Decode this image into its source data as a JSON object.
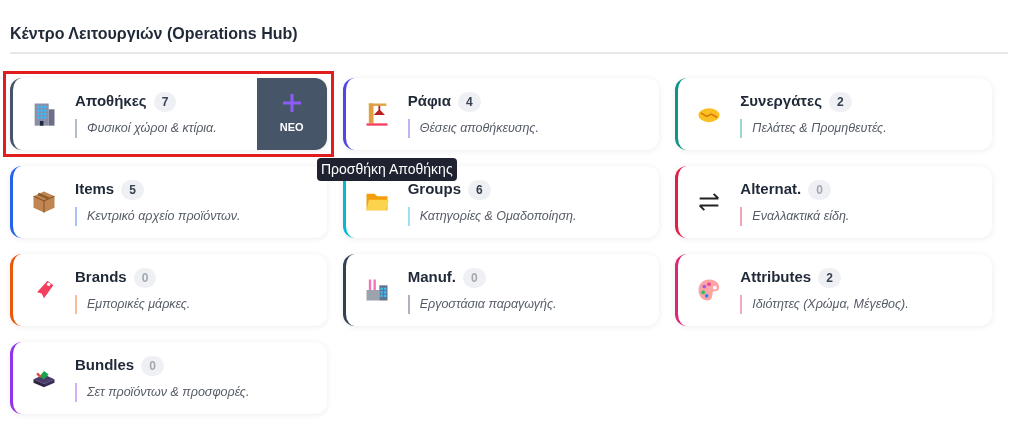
{
  "section_title": "Κέντρο Λειτουργιών (Operations Hub)",
  "cards": [
    {
      "title": "Αποθήκες",
      "count": "7",
      "empty": false,
      "description": "Φυσικοί χώροι & κτίρια.",
      "color": "#475569",
      "highlighted": true,
      "add_button": {
        "label": "ΝΕΟ",
        "tooltip": "Προσθήκη Αποθήκης"
      }
    },
    {
      "title": "Ράφια",
      "count": "4",
      "empty": false,
      "description": "Θέσεις αποθήκευσης.",
      "color": "#4f46e5",
      "highlighted": false
    },
    {
      "title": "Συνεργάτες",
      "count": "2",
      "empty": false,
      "description": "Πελάτες & Προμηθευτές.",
      "color": "#0d9488",
      "highlighted": false
    },
    {
      "title": "Items",
      "count": "5",
      "empty": false,
      "description": "Κεντρικό αρχείο προϊόντων.",
      "color": "#2563eb",
      "highlighted": false
    },
    {
      "title": "Groups",
      "count": "6",
      "empty": false,
      "description": "Κατηγορίες & Ομαδοποίηση.",
      "color": "#06b6d4",
      "highlighted": false
    },
    {
      "title": "Alternat.",
      "count": "0",
      "empty": true,
      "description": "Εναλλακτικά είδη.",
      "color": "#e11d48",
      "highlighted": false
    },
    {
      "title": "Brands",
      "count": "0",
      "empty": true,
      "description": "Εμπορικές μάρκες.",
      "color": "#ea580c",
      "highlighted": false
    },
    {
      "title": "Manuf.",
      "count": "0",
      "empty": true,
      "description": "Εργοστάσια παραγωγής.",
      "color": "#334155",
      "highlighted": false
    },
    {
      "title": "Attributes",
      "count": "2",
      "empty": false,
      "description": "Ιδιότητες (Χρώμα, Μέγεθος).",
      "color": "#db2777",
      "highlighted": false
    },
    {
      "title": "Bundles",
      "count": "0",
      "empty": true,
      "description": "Σετ προϊόντων & προσφορές.",
      "color": "#9333ea",
      "highlighted": false
    }
  ]
}
